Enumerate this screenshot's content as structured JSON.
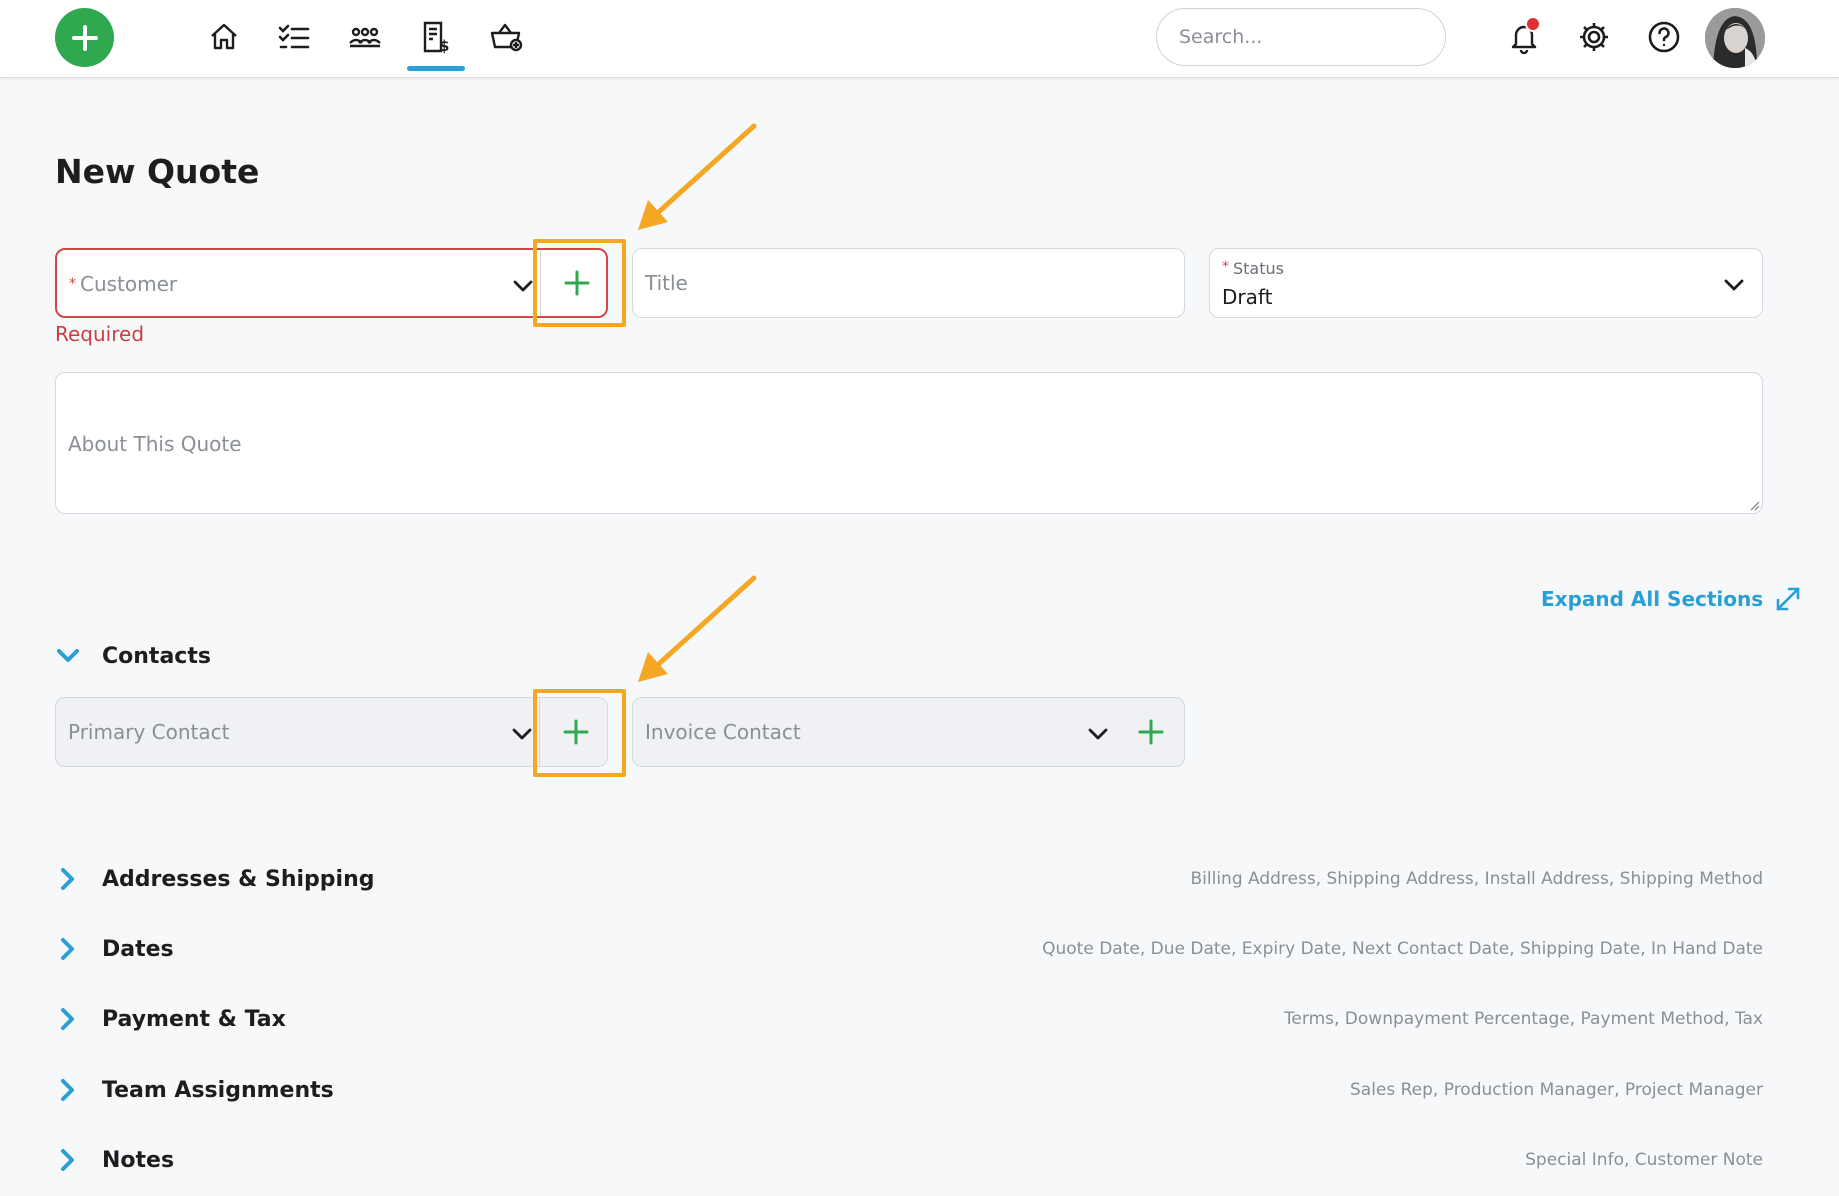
{
  "topbar": {
    "nav": [
      {
        "name": "home-icon"
      },
      {
        "name": "tasks-list-icon"
      },
      {
        "name": "customers-icon"
      },
      {
        "name": "quotes-invoice-icon",
        "active": true
      },
      {
        "name": "shop-basket-icon"
      }
    ],
    "search_placeholder": "Search...",
    "accent": "#2a9fd6",
    "brand_green": "#2fa84f"
  },
  "page": {
    "title": "New Quote"
  },
  "form": {
    "customer": {
      "placeholder": "Customer",
      "required_mark": "*",
      "error": "Required"
    },
    "title": {
      "placeholder": "Title"
    },
    "status": {
      "label": "Status",
      "required_mark": "*",
      "value": "Draft"
    },
    "about": {
      "placeholder": "About This Quote"
    }
  },
  "expand_all": "Expand All Sections",
  "contacts": {
    "label": "Contacts",
    "primary_placeholder": "Primary Contact",
    "invoice_placeholder": "Invoice Contact"
  },
  "sections": [
    {
      "label": "Addresses & Shipping",
      "hint": "Billing Address, Shipping Address, Install Address, Shipping Method"
    },
    {
      "label": "Dates",
      "hint": "Quote Date, Due Date, Expiry Date, Next Contact Date, Shipping Date, In Hand Date"
    },
    {
      "label": "Payment & Tax",
      "hint": "Terms, Downpayment Percentage, Payment Method, Tax"
    },
    {
      "label": "Team Assignments",
      "hint": "Sales Rep, Production Manager, Project Manager"
    },
    {
      "label": "Notes",
      "hint": "Special Info, Customer Note"
    }
  ],
  "colors": {
    "error": "#d64545",
    "annotation": "#f5a623"
  }
}
